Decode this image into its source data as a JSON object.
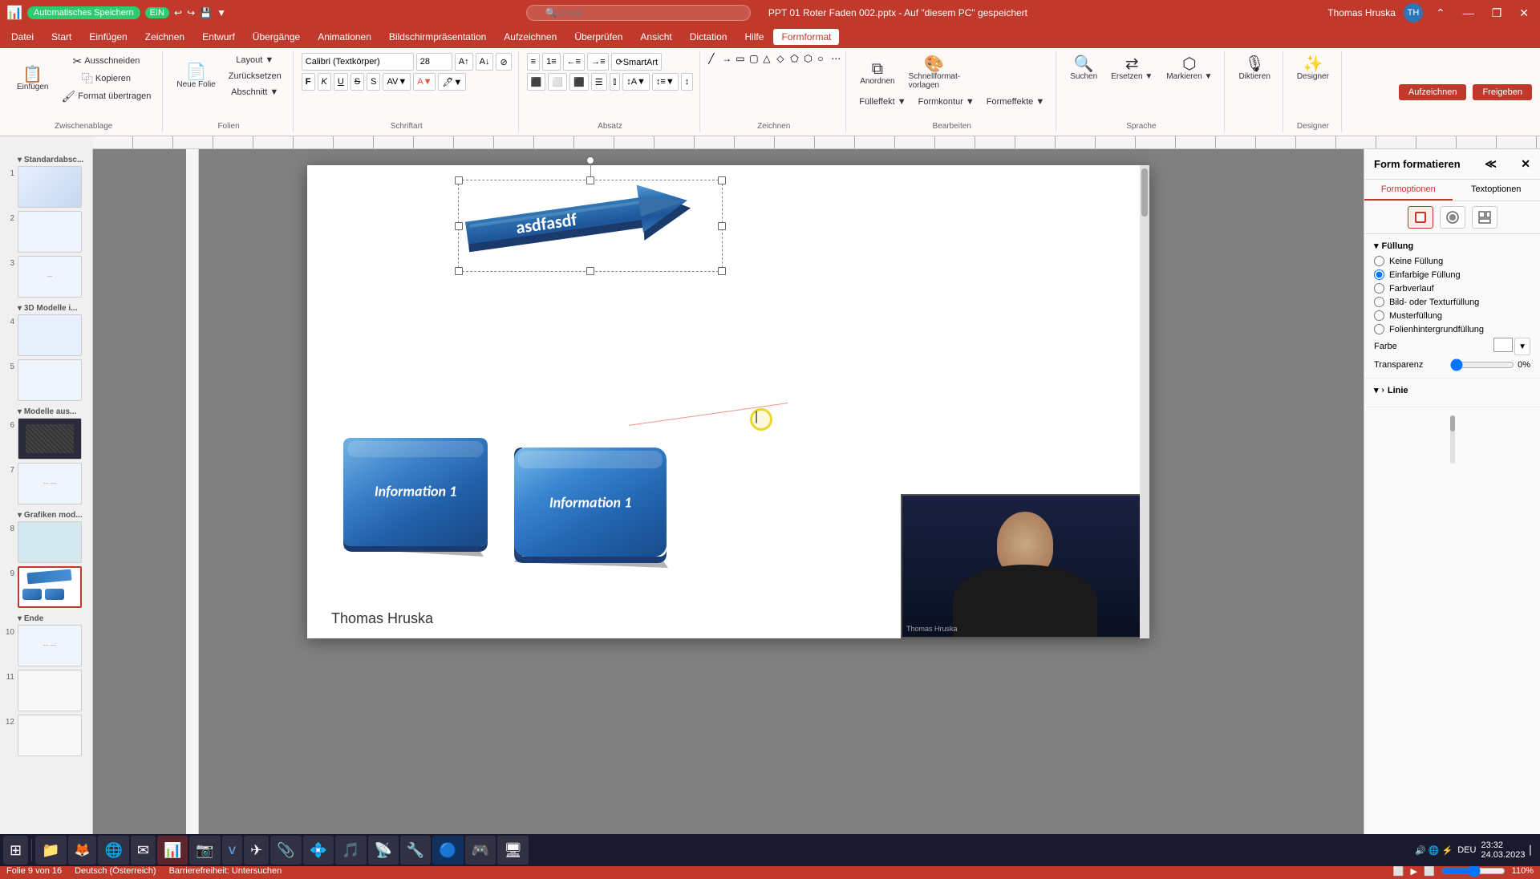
{
  "titlebar": {
    "autosave": "Automatisches Speichern",
    "autosave_state": "EIN",
    "title": "PPT 01 Roter Faden 002.pptx - Auf \"diesem PC\" gespeichert",
    "user": "Thomas Hruska",
    "user_initials": "TH",
    "search_placeholder": "Suchen",
    "min": "—",
    "max": "❐",
    "close": "✕"
  },
  "menubar": {
    "items": [
      "Datei",
      "Start",
      "Einfügen",
      "Zeichnen",
      "Entwurf",
      "Übergänge",
      "Animationen",
      "Bildschirmpräsentation",
      "Aufzeichnen",
      "Überprüfen",
      "Ansicht",
      "Dictation",
      "Hilfe",
      "Formformat"
    ]
  },
  "ribbon": {
    "clipboard_group": "Zwischenablage",
    "slides_group": "Folien",
    "font_group": "Schriftart",
    "paragraph_group": "Absatz",
    "drawing_group": "Zeichnen",
    "edit_group": "Bearbeiten",
    "language_group": "Sprache",
    "designer_group": "Designer",
    "font_name": "Calibri (Textkörper)",
    "font_size": "28",
    "bold": "F",
    "italic": "K",
    "underline": "U",
    "strikethrough": "S",
    "neue_folie": "Neue Folie",
    "layout": "Layout",
    "reset": "Zurücksetzen",
    "abschnitt": "Abschnitt",
    "ausschneiden": "Ausschneiden",
    "kopieren": "Kopieren",
    "format_uebertragen": "Format übertragen",
    "designer_btn": "Designer",
    "diktieren": "Diktieren",
    "aufzeichnen": "Aufzeichnen",
    "freigeben": "Freigeben"
  },
  "slide_thumbnails": [
    {
      "num": "1",
      "label": ""
    },
    {
      "num": "2",
      "label": ""
    },
    {
      "num": "3",
      "label": ""
    },
    {
      "num": "",
      "label": "3D Modelle i..."
    },
    {
      "num": "4",
      "label": ""
    },
    {
      "num": "5",
      "label": ""
    },
    {
      "num": "",
      "label": "Modelle aus..."
    },
    {
      "num": "6",
      "label": ""
    },
    {
      "num": "7",
      "label": ""
    },
    {
      "num": "",
      "label": "Grafiken mod..."
    },
    {
      "num": "8",
      "label": ""
    },
    {
      "num": "9",
      "label": ""
    },
    {
      "num": "",
      "label": "Ende"
    },
    {
      "num": "10",
      "label": ""
    },
    {
      "num": "11",
      "label": ""
    },
    {
      "num": "12",
      "label": ""
    }
  ],
  "slide": {
    "arrow_text": "asdfasdf",
    "info1_left": "Information 1",
    "info1_right": "Information 1",
    "presenter_name": "Thomas Hruska"
  },
  "right_panel": {
    "title": "Form formatieren",
    "tab1": "Formoptionen",
    "tab2": "Textoptionen",
    "section_fill": "Füllung",
    "fill_none": "Keine Füllung",
    "fill_solid": "Einfarbige Füllung",
    "fill_gradient": "Farbverlauf",
    "fill_texture": "Bild- oder Texturfüllung",
    "fill_pattern": "Musterfüllung",
    "fill_slide_bg": "Folienhintergrundfüllung",
    "color_label": "Farbe",
    "transparency_label": "Transparenz",
    "transparency_value": "0%",
    "section_line": "Linie"
  },
  "statusbar": {
    "slide_info": "Folie 9 von 16",
    "language": "Deutsch (Österreich)",
    "accessibility": "Barrierefreiheit: Untersuchen",
    "time": "23:32",
    "date": "24.03.2023",
    "zoom": "110%"
  },
  "taskbar": {
    "icons": [
      "⊞",
      "📁",
      "🦊",
      "🌐",
      "✉",
      "💻",
      "📷",
      "V",
      "✈",
      "📎",
      "💠",
      "🎵",
      "📡",
      "🔧",
      "🔵",
      "🎮",
      "🖥"
    ]
  }
}
